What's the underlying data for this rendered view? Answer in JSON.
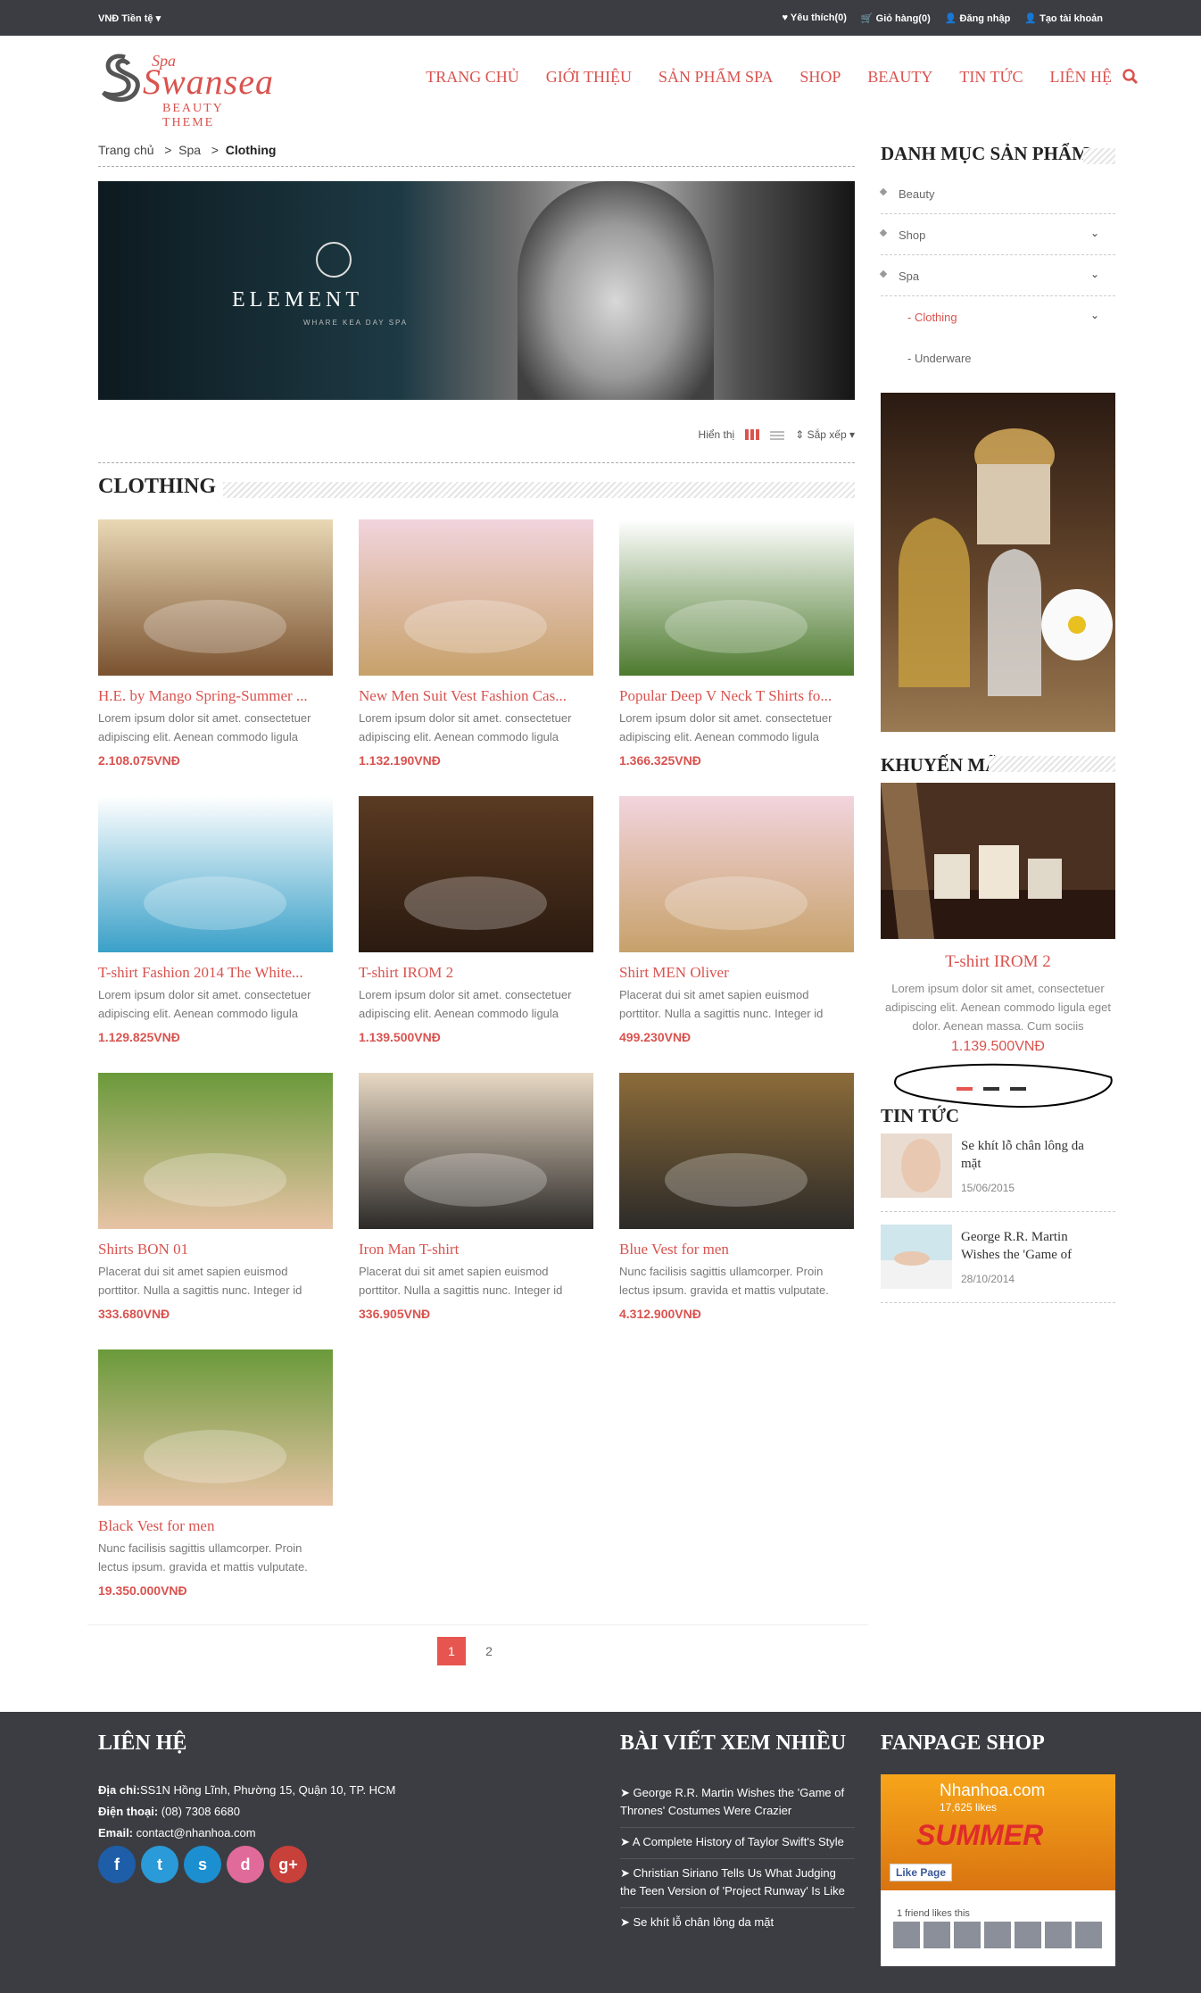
{
  "topbar": {
    "currency": "VNĐ Tiền tệ ▾",
    "wishlist": "♥ Yêu thích(0)",
    "cart": "🛒 Giỏ hàng(0)",
    "login": "👤 Đăng nhập",
    "register": "👤 Tạo tài khoản"
  },
  "logo": {
    "spa": "Spa",
    "name": "Swansea",
    "sub": "BEAUTY THEME"
  },
  "nav": [
    "TRANG CHỦ",
    "GIỚI THIỆU",
    "SẢN PHẨM SPA",
    "SHOP",
    "BEAUTY",
    "TIN TỨC",
    "LIÊN HỆ"
  ],
  "breadcrumb": {
    "home": "Trang chủ",
    "spa": "Spa",
    "current": "Clothing",
    "sep": ">"
  },
  "banner": {
    "brand": "ELEMENT",
    "tagline": "WHARE KEA DAY SPA"
  },
  "toolbar": {
    "display": "Hiển thị",
    "sort": "⇕ Sắp xếp ▾"
  },
  "section_title": "CLOTHING",
  "products": [
    {
      "name": "H.E. by Mango Spring-Summer ...",
      "desc": "Lorem ipsum dolor sit amet. consectetuer adipiscing elit. Aenean commodo ligula",
      "price": "2.108.075VNĐ",
      "c1": "#e9d8b5",
      "c2": "#7a5230"
    },
    {
      "name": "New Men Suit Vest Fashion Cas...",
      "desc": "Lorem ipsum dolor sit amet. consectetuer adipiscing elit. Aenean commodo ligula",
      "price": "1.132.190VNĐ",
      "c1": "#f2d4dd",
      "c2": "#c7a16a"
    },
    {
      "name": "Popular Deep V Neck T Shirts fo...",
      "desc": "Lorem ipsum dolor sit amet. consectetuer adipiscing elit. Aenean commodo ligula",
      "price": "1.366.325VNĐ",
      "c1": "#ffffff",
      "c2": "#4d7a2e"
    },
    {
      "name": "T-shirt Fashion 2014 The White...",
      "desc": "Lorem ipsum dolor sit amet. consectetuer adipiscing elit. Aenean commodo ligula",
      "price": "1.129.825VNĐ",
      "c1": "#ffffff",
      "c2": "#3aa0c8"
    },
    {
      "name": "T-shirt IROM 2",
      "desc": "Lorem ipsum dolor sit amet. consectetuer adipiscing elit. Aenean commodo ligula",
      "price": "1.139.500VNĐ",
      "c1": "#5a3a22",
      "c2": "#2a1a10"
    },
    {
      "name": "Shirt MEN Oliver",
      "desc": "Placerat dui sit amet sapien euismod porttitor. Nulla a sagittis nunc. Integer id",
      "price": "499.230VNĐ",
      "c1": "#f2d4dd",
      "c2": "#c7a16a"
    },
    {
      "name": "Shirts BON 01",
      "desc": "Placerat dui sit amet sapien euismod porttitor. Nulla a sagittis nunc. Integer id",
      "price": "333.680VNĐ",
      "c1": "#6a9a3a",
      "c2": "#e7c3a5"
    },
    {
      "name": "Iron Man T-shirt",
      "desc": "Placerat dui sit amet sapien euismod porttitor. Nulla a sagittis nunc. Integer id",
      "price": "336.905VNĐ",
      "c1": "#e8d9c4",
      "c2": "#2c2a28"
    },
    {
      "name": "Blue Vest for men",
      "desc": "Nunc facilisis sagittis ullamcorper. Proin lectus ipsum. gravida et mattis vulputate.",
      "price": "4.312.900VNĐ",
      "c1": "#8c6c3a",
      "c2": "#2c2a28"
    },
    {
      "name": "Black Vest for men",
      "desc": "Nunc facilisis sagittis ullamcorper. Proin lectus ipsum. gravida et mattis vulputate.",
      "price": "19.350.000VNĐ",
      "c1": "#6a9a3a",
      "c2": "#e7c3a5"
    }
  ],
  "pager": {
    "p1": "1",
    "p2": "2"
  },
  "sidebar": {
    "cat_title": "DANH MỤC SẢN PHẨM",
    "categories": [
      "Beauty",
      "Shop",
      "Spa",
      "- Clothing",
      "- Underware"
    ],
    "promo_title": "KHUYẾN MÃI",
    "promo": {
      "name": "T-shirt IROM 2",
      "desc": "Lorem ipsum dolor sit amet, consectetuer adipiscing elit. Aenean commodo ligula eget dolor. Aenean massa. Cum sociis",
      "price": "1.139.500VNĐ"
    },
    "news_title": "TIN TỨC",
    "news": [
      {
        "title": "Se khít lỗ chân lông da mặt",
        "date": "15/06/2015"
      },
      {
        "title": "George R.R. Martin Wishes the 'Game of",
        "date": "28/10/2014"
      }
    ]
  },
  "footer": {
    "contact_title": "LIÊN HỆ",
    "address_label": "Địa chỉ:",
    "address": "SS1N Hồng Lĩnh, Phường 15, Quận 10, TP. HCM",
    "phone_label": "Điện thoại:",
    "phone": "(08) 7308 6680",
    "email_label": "Email:",
    "email": "contact@nhanhoa.com",
    "social": [
      "f",
      "t",
      "s",
      "d",
      "g+"
    ],
    "posts_title": "BÀI VIẾT XEM NHIỀU",
    "posts": [
      "George R.R. Martin Wishes the 'Game of Thrones' Costumes Were Crazier",
      "A Complete History of Taylor Swift's Style",
      "Christian Siriano Tells Us What Judging the Teen Version of 'Project Runway' Is Like",
      "Se khít lỗ chân lông da mặt"
    ],
    "fan_title": "FANPAGE SHOP",
    "fan_page": "Nhanhoa.com",
    "fan_likes": "17,625 likes",
    "fan_summer": "SUMMER",
    "fan_like_btn": "Like Page",
    "fan_friends": "1 friend likes this"
  },
  "colors": {
    "accent": "#d9534f",
    "dark": "#3b3d42"
  }
}
